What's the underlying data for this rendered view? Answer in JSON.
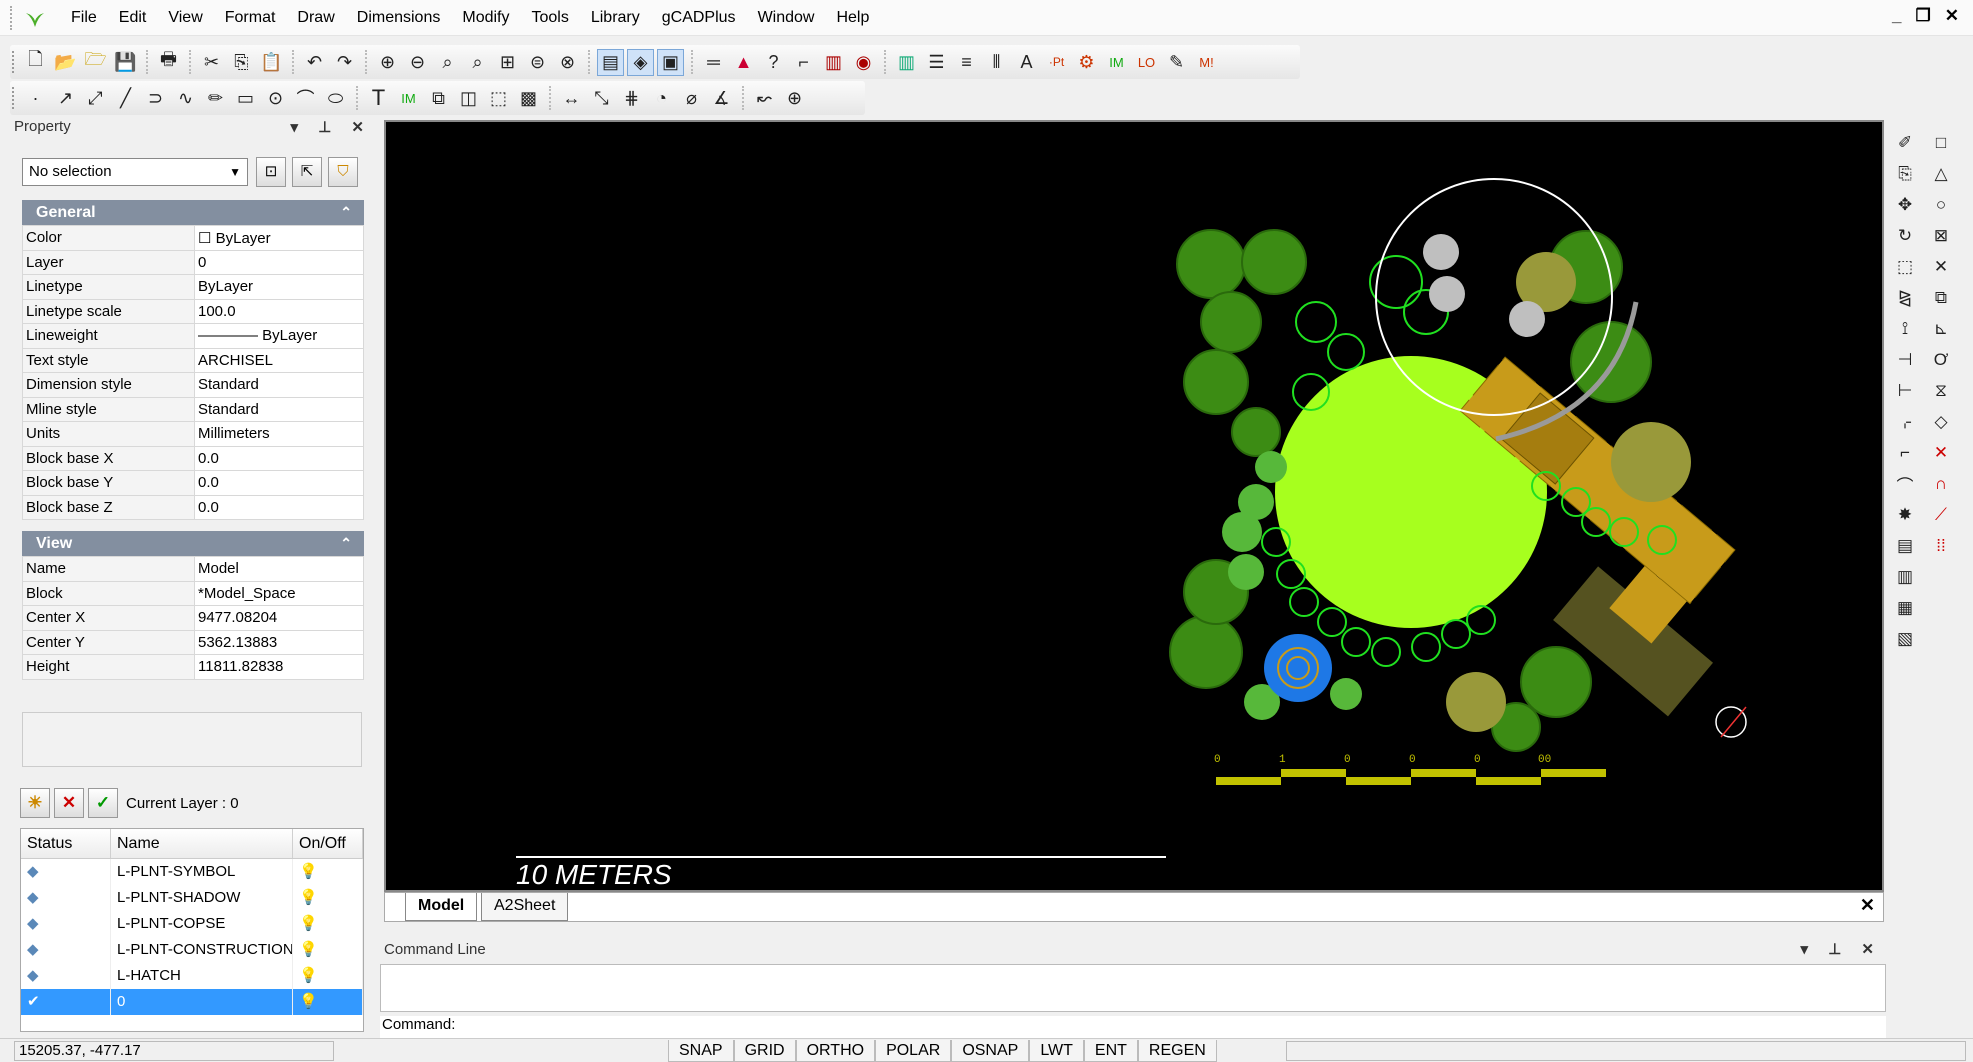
{
  "menu": [
    "File",
    "Edit",
    "View",
    "Format",
    "Draw",
    "Dimensions",
    "Modify",
    "Tools",
    "Library",
    "gCADPlus",
    "Window",
    "Help"
  ],
  "window_controls": {
    "minimize": "_",
    "restore": "❐",
    "close": "✕"
  },
  "property_panel": {
    "title": "Property",
    "controls": "▾ ⊥ ✕",
    "selection_value": "No selection",
    "general_title": "General",
    "general": [
      {
        "k": "Color",
        "v": "☐ ByLayer"
      },
      {
        "k": "Layer",
        "v": "0"
      },
      {
        "k": "Linetype",
        "v": "ByLayer"
      },
      {
        "k": "Linetype scale",
        "v": "100.0"
      },
      {
        "k": "Lineweight",
        "v": "———— ByLayer"
      },
      {
        "k": "Text style",
        "v": "ARCHISEL"
      },
      {
        "k": "Dimension style",
        "v": "Standard"
      },
      {
        "k": "Mline style",
        "v": "Standard"
      },
      {
        "k": "Units",
        "v": "Millimeters"
      },
      {
        "k": "Block base X",
        "v": "0.0"
      },
      {
        "k": "Block base Y",
        "v": "0.0"
      },
      {
        "k": "Block base Z",
        "v": "0.0"
      }
    ],
    "view_title": "View",
    "view": [
      {
        "k": "Name",
        "v": "Model"
      },
      {
        "k": "Block",
        "v": "*Model_Space"
      },
      {
        "k": "Center X",
        "v": "9477.08204"
      },
      {
        "k": "Center Y",
        "v": "5362.13883"
      },
      {
        "k": "Height",
        "v": "11811.82838"
      }
    ]
  },
  "layers": {
    "current_label": "Current Layer : 0",
    "headers": [
      "Status",
      "Name",
      "On/Off"
    ],
    "rows": [
      {
        "name": "L-PLNT-SYMBOL",
        "selected": false
      },
      {
        "name": "L-PLNT-SHADOW",
        "selected": false
      },
      {
        "name": "L-PLNT-COPSE",
        "selected": false
      },
      {
        "name": "L-PLNT-CONSTRUCTION",
        "selected": false
      },
      {
        "name": "L-HATCH",
        "selected": false
      },
      {
        "name": "0",
        "selected": true
      }
    ]
  },
  "drawing": {
    "scale_label": "10 METERS",
    "scale_ticks": [
      "0",
      "1",
      "0",
      "0",
      "0",
      "00"
    ]
  },
  "tabs": [
    {
      "label": "Model",
      "active": true
    },
    {
      "label": "A2Sheet",
      "active": false
    }
  ],
  "command": {
    "title": "Command Line",
    "controls": "▾ ⊥ ✕",
    "prompt": "Command:"
  },
  "status": {
    "coords": "15205.37,  -477.17",
    "buttons": [
      "SNAP",
      "GRID",
      "ORTHO",
      "POLAR",
      "OSNAP",
      "LWT",
      "ENT",
      "REGEN"
    ]
  },
  "colors": {
    "lawn": "#a7ff1e",
    "tree_dark": "#3c8c14",
    "paving": "#c89b1a",
    "pond": "#1e78e6",
    "shrub_olive": "#99993a"
  }
}
